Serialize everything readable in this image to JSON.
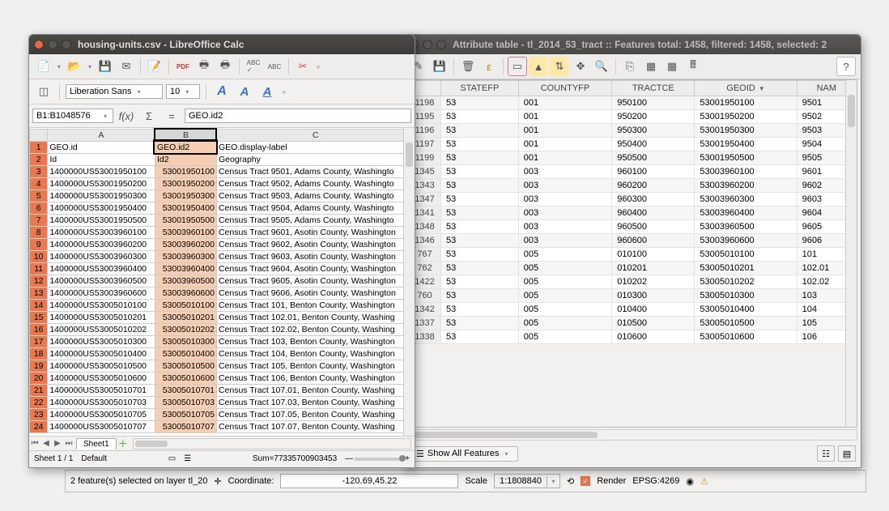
{
  "calc": {
    "title": "housing-units.csv - LibreOffice Calc",
    "font_name": "Liberation Sans",
    "font_size": "10",
    "name_box": "B1:B1048576",
    "formula": "GEO.id2",
    "col_headers": [
      "A",
      "B",
      "C"
    ],
    "header_row": [
      "GEO.id",
      "GEO.id2",
      "GEO.display-label"
    ],
    "subheader_row": [
      "Id",
      "Id2",
      "Geography"
    ],
    "rows": [
      [
        "1400000US53001950100",
        "53001950100",
        "Census Tract 9501, Adams County, Washingto"
      ],
      [
        "1400000US53001950200",
        "53001950200",
        "Census Tract 9502, Adams County, Washingto"
      ],
      [
        "1400000US53001950300",
        "53001950300",
        "Census Tract 9503, Adams County, Washingto"
      ],
      [
        "1400000US53001950400",
        "53001950400",
        "Census Tract 9504, Adams County, Washingto"
      ],
      [
        "1400000US53001950500",
        "53001950500",
        "Census Tract 9505, Adams County, Washingto"
      ],
      [
        "1400000US53003960100",
        "53003960100",
        "Census Tract 9601, Asotin County, Washington"
      ],
      [
        "1400000US53003960200",
        "53003960200",
        "Census Tract 9602, Asotin County, Washington"
      ],
      [
        "1400000US53003960300",
        "53003960300",
        "Census Tract 9603, Asotin County, Washington"
      ],
      [
        "1400000US53003960400",
        "53003960400",
        "Census Tract 9604, Asotin County, Washington"
      ],
      [
        "1400000US53003960500",
        "53003960500",
        "Census Tract 9605, Asotin County, Washington"
      ],
      [
        "1400000US53003960600",
        "53003960600",
        "Census Tract 9606, Asotin County, Washington"
      ],
      [
        "1400000US53005010100",
        "53005010100",
        "Census Tract 101, Benton County, Washington"
      ],
      [
        "1400000US53005010201",
        "53005010201",
        "Census Tract 102.01, Benton County, Washing"
      ],
      [
        "1400000US53005010202",
        "53005010202",
        "Census Tract 102.02, Benton County, Washing"
      ],
      [
        "1400000US53005010300",
        "53005010300",
        "Census Tract 103, Benton County, Washington"
      ],
      [
        "1400000US53005010400",
        "53005010400",
        "Census Tract 104, Benton County, Washington"
      ],
      [
        "1400000US53005010500",
        "53005010500",
        "Census Tract 105, Benton County, Washington"
      ],
      [
        "1400000US53005010600",
        "53005010600",
        "Census Tract 106, Benton County, Washington"
      ],
      [
        "1400000US53005010701",
        "53005010701",
        "Census Tract 107.01, Benton County, Washing"
      ],
      [
        "1400000US53005010703",
        "53005010703",
        "Census Tract 107.03, Benton County, Washing"
      ],
      [
        "1400000US53005010705",
        "53005010705",
        "Census Tract 107.05, Benton County, Washing"
      ],
      [
        "1400000US53005010707",
        "53005010707",
        "Census Tract 107.07, Benton County, Washing"
      ]
    ],
    "sheet_tab": "Sheet1",
    "status_sheet": "Sheet 1 / 1",
    "status_style": "Default",
    "status_sum": "Sum=77335700903453"
  },
  "attr": {
    "title": "Attribute table - tl_2014_53_tract :: Features total: 1458, filtered: 1458, selected: 2",
    "columns": [
      "STATEFP",
      "COUNTYFP",
      "TRACTCE",
      "GEOID",
      "NAM"
    ],
    "sort_col": "GEOID",
    "rows": [
      {
        "n": "1198",
        "c": [
          "53",
          "001",
          "950100",
          "53001950100",
          "9501"
        ]
      },
      {
        "n": "1195",
        "c": [
          "53",
          "001",
          "950200",
          "53001950200",
          "9502"
        ]
      },
      {
        "n": "1196",
        "c": [
          "53",
          "001",
          "950300",
          "53001950300",
          "9503"
        ]
      },
      {
        "n": "1197",
        "c": [
          "53",
          "001",
          "950400",
          "53001950400",
          "9504"
        ]
      },
      {
        "n": "1199",
        "c": [
          "53",
          "001",
          "950500",
          "53001950500",
          "9505"
        ]
      },
      {
        "n": "1345",
        "c": [
          "53",
          "003",
          "960100",
          "53003960100",
          "9601"
        ]
      },
      {
        "n": "1343",
        "c": [
          "53",
          "003",
          "960200",
          "53003960200",
          "9602"
        ]
      },
      {
        "n": "1347",
        "c": [
          "53",
          "003",
          "960300",
          "53003960300",
          "9603"
        ]
      },
      {
        "n": "1341",
        "c": [
          "53",
          "003",
          "960400",
          "53003960400",
          "9604"
        ]
      },
      {
        "n": "1348",
        "c": [
          "53",
          "003",
          "960500",
          "53003960500",
          "9605"
        ]
      },
      {
        "n": "1346",
        "c": [
          "53",
          "003",
          "960600",
          "53003960600",
          "9606"
        ]
      },
      {
        "n": "767",
        "c": [
          "53",
          "005",
          "010100",
          "53005010100",
          "101"
        ]
      },
      {
        "n": "762",
        "c": [
          "53",
          "005",
          "010201",
          "53005010201",
          "102.01"
        ]
      },
      {
        "n": "1422",
        "c": [
          "53",
          "005",
          "010202",
          "53005010202",
          "102.02"
        ]
      },
      {
        "n": "760",
        "c": [
          "53",
          "005",
          "010300",
          "53005010300",
          "103"
        ]
      },
      {
        "n": "1342",
        "c": [
          "53",
          "005",
          "010400",
          "53005010400",
          "104"
        ]
      },
      {
        "n": "1337",
        "c": [
          "53",
          "005",
          "010500",
          "53005010500",
          "105"
        ]
      },
      {
        "n": "1338",
        "c": [
          "53",
          "005",
          "010600",
          "53005010600",
          "106"
        ]
      }
    ],
    "show_all": "Show All Features",
    "help_icon": "?"
  },
  "qgis": {
    "sel_msg": "2 feature(s) selected on layer tl_20",
    "coord_label": "Coordinate:",
    "coord_value": "-120.69,45.22",
    "scale_label": "Scale",
    "scale_value": "1:1808840",
    "render_label": "Render",
    "crs": "EPSG:4269"
  }
}
